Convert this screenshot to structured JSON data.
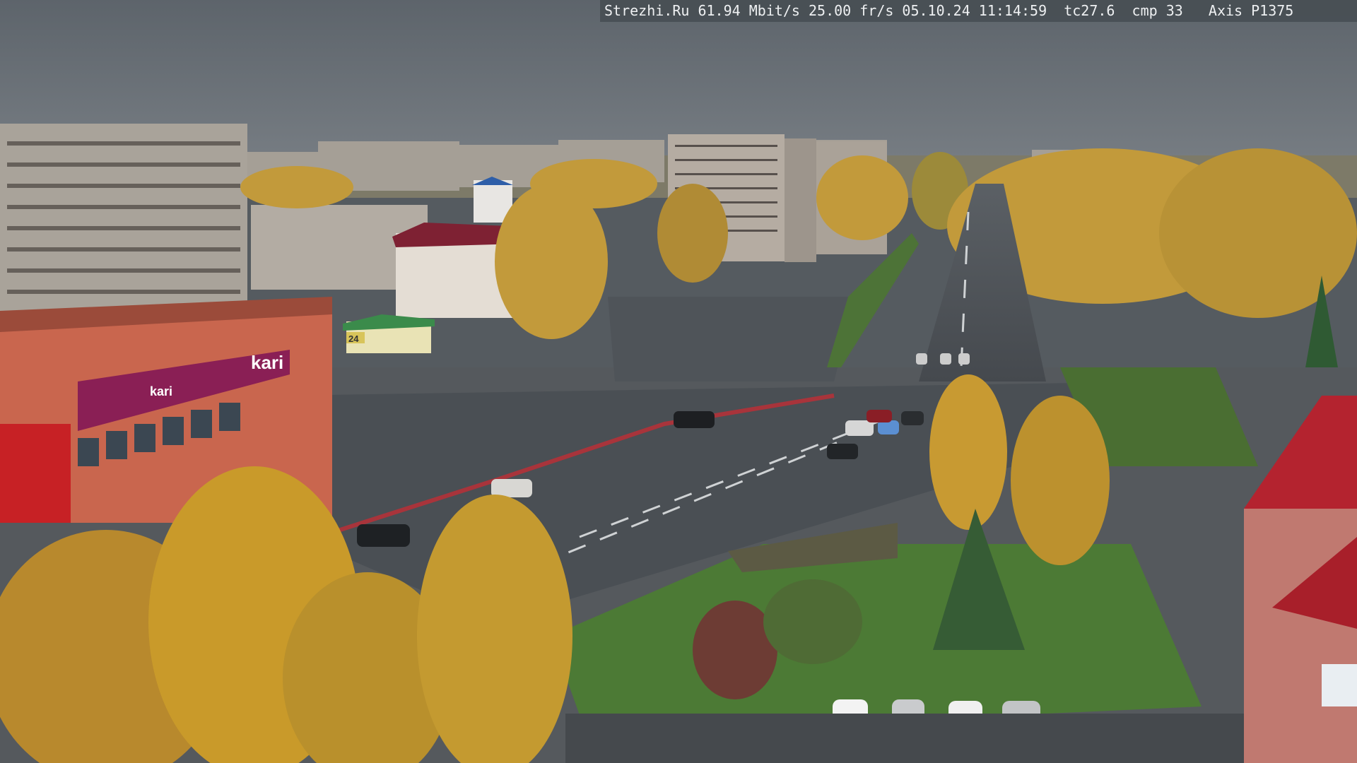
{
  "overlay": {
    "text": "Strezhi.Ru 61.94 Mbit/s 25.00 fr/s 05.10.24 11:14:59  tc27.6  cmp 33   Axis P1375"
  },
  "signs": {
    "kari_main": "kari",
    "kari_small": "kari",
    "store_number": "24"
  },
  "colors": {
    "sky": "#646b72",
    "asphalt": "#4d5257",
    "grass": "#4f7a3a",
    "foliage_yellow": "#c99a2a",
    "store_facade": "#c9664e",
    "kari_magenta": "#8a1f55",
    "roof_red": "#b4232f"
  }
}
